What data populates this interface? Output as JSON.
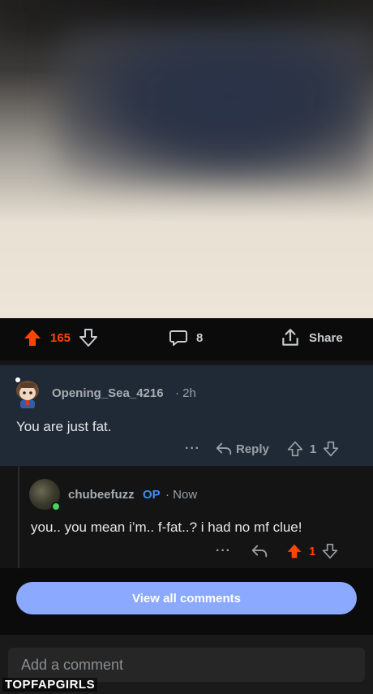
{
  "post": {
    "upvotes": "165",
    "comments": "8",
    "share_label": "Share"
  },
  "comment1": {
    "username": "Opening_Sea_4216",
    "time": "· 2h",
    "body": "You are just fat.",
    "more": "···",
    "reply_label": "Reply",
    "score": "1"
  },
  "comment2": {
    "username": "chubeefuzz",
    "op_badge": "OP",
    "time": "· Now",
    "body": "you.. you mean i’m.. f-fat..? i had no mf clue!",
    "more": "···",
    "score": "1"
  },
  "view_all_label": "View all comments",
  "add_comment_placeholder": "Add a comment",
  "watermark": "TOPFAPGIRLS",
  "colors": {
    "upvote": "#ff4500",
    "op": "#3d8bff",
    "button": "#8ba9ff",
    "highlight": "#202a36"
  }
}
